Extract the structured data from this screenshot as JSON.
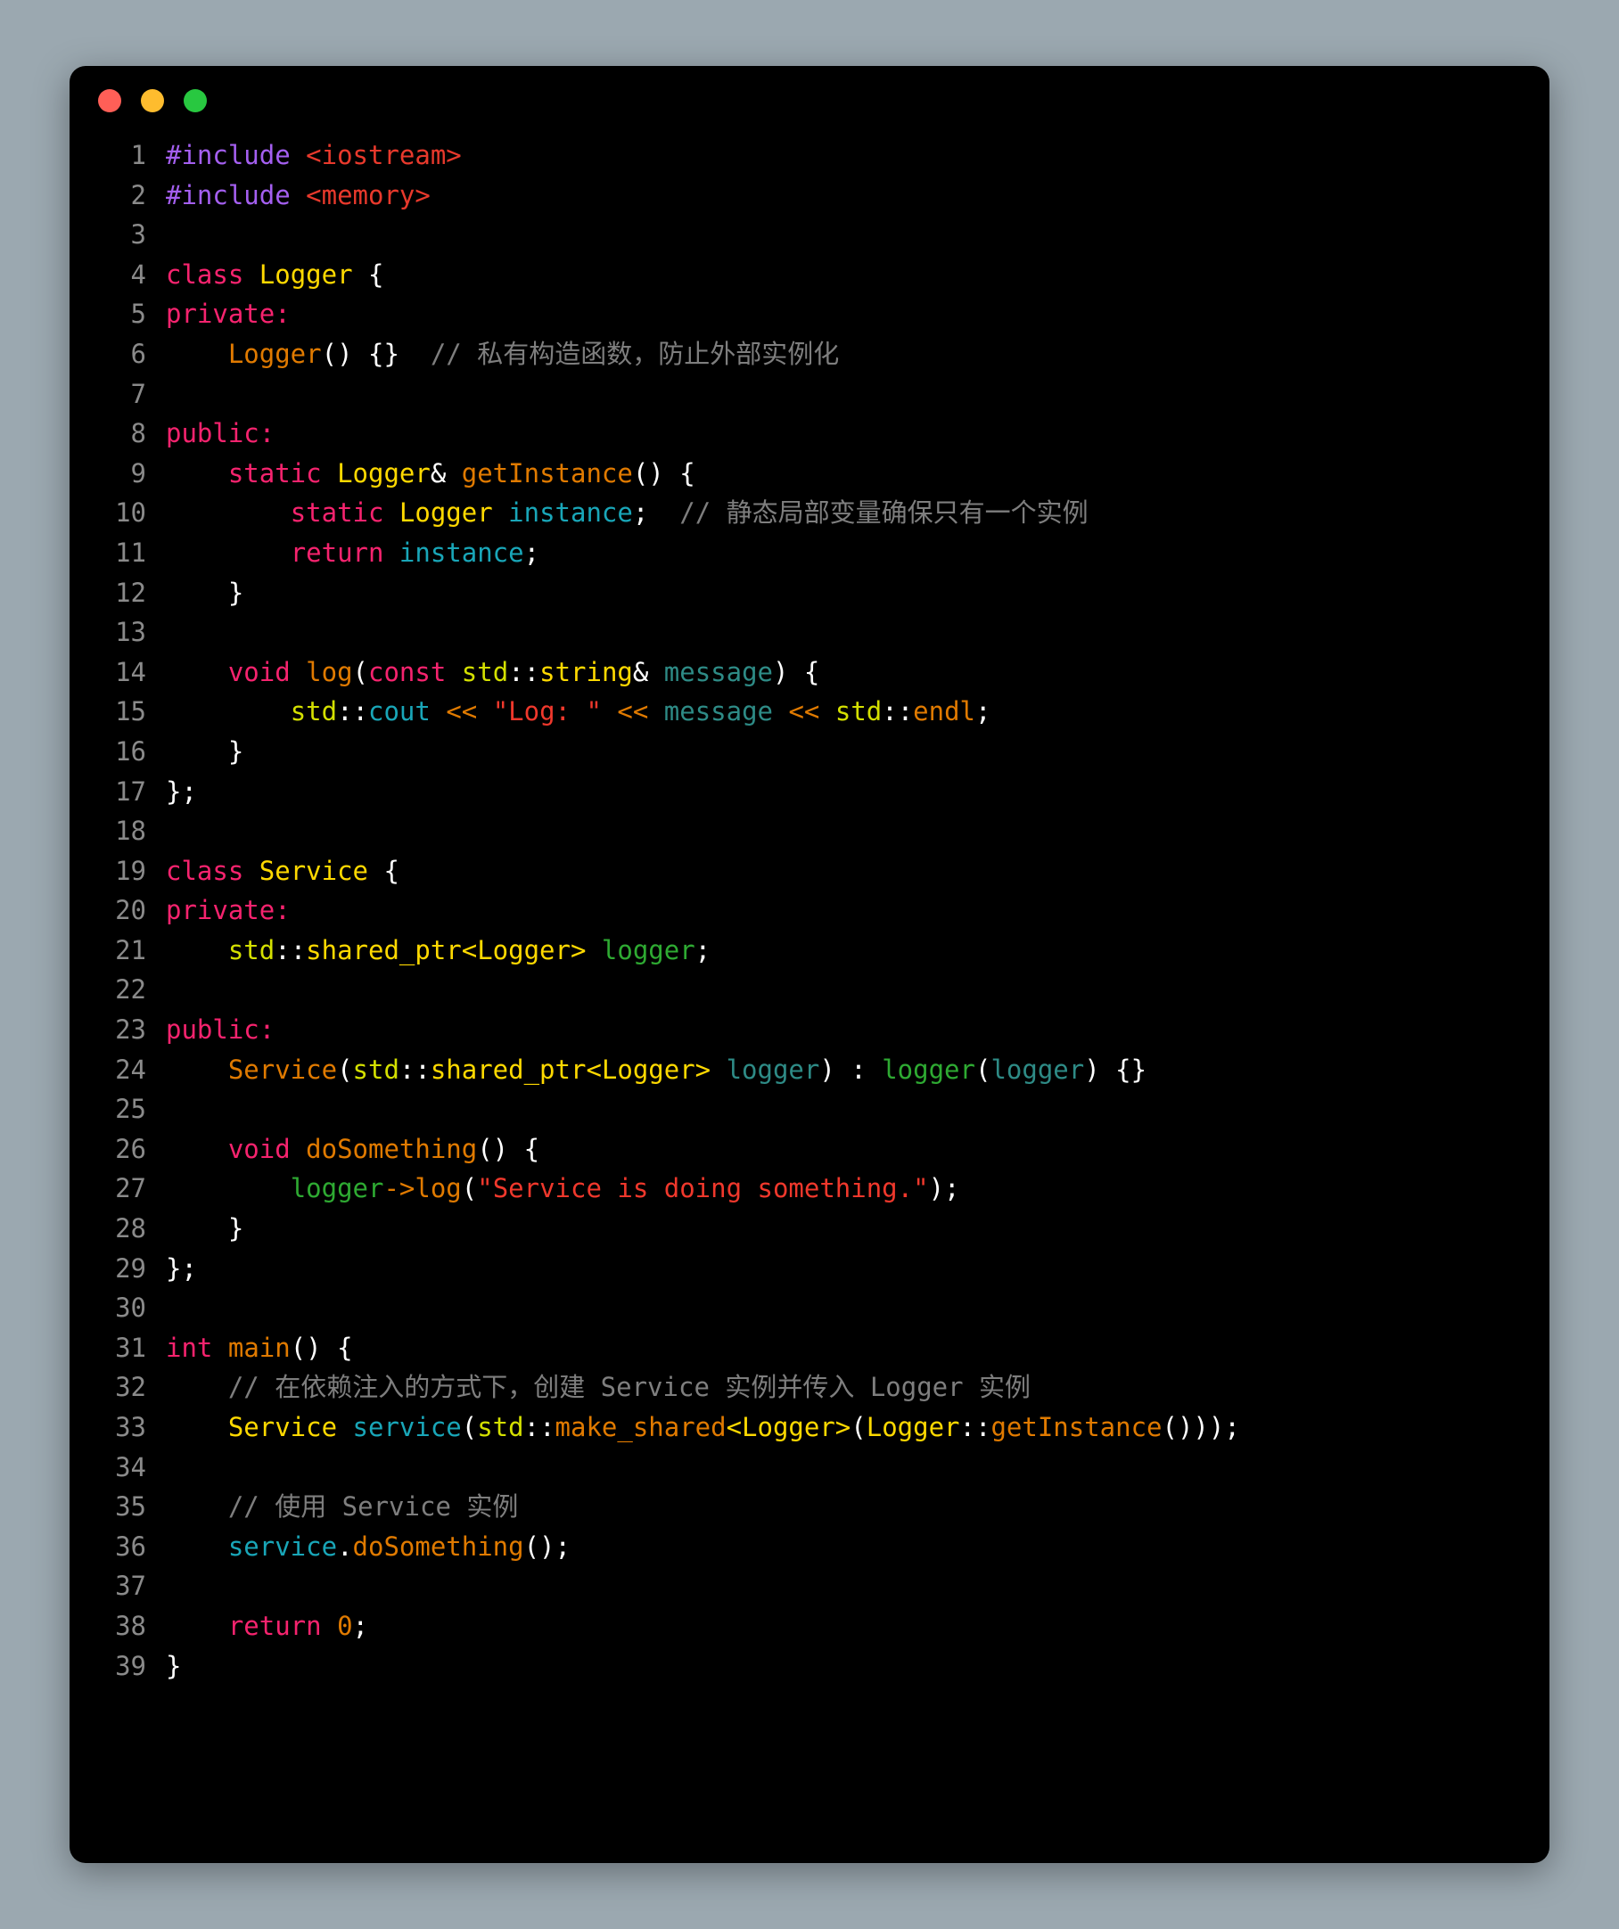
{
  "window": {
    "traffic_lights": [
      {
        "name": "close",
        "color": "#ff5f57"
      },
      {
        "name": "minimize",
        "color": "#febc2e"
      },
      {
        "name": "maximize",
        "color": "#28c840"
      }
    ]
  },
  "editor": {
    "language": "cpp",
    "background": "#000000",
    "line_number_color": "#8a8a8a",
    "total_lines": 39,
    "palette": {
      "preprocessor": "#a45ff0",
      "include_path": "#e8392c",
      "keyword": "#f6236e",
      "type": "#ffd900",
      "namespace": "#d4e000",
      "function": "#e07a00",
      "operator": "#e07a00",
      "variable": "#19a6b8",
      "parameter": "#2e8b86",
      "member": "#2eaa32",
      "string": "#f0382c",
      "comment": "#7e7e7e",
      "punctuation": "#ffffff"
    },
    "lines": [
      {
        "n": "1",
        "text": "#include <iostream>"
      },
      {
        "n": "2",
        "text": "#include <memory>"
      },
      {
        "n": "3",
        "text": ""
      },
      {
        "n": "4",
        "text": "class Logger {"
      },
      {
        "n": "5",
        "text": "private:"
      },
      {
        "n": "6",
        "text": "    Logger() {}  // 私有构造函数，防止外部实例化"
      },
      {
        "n": "7",
        "text": ""
      },
      {
        "n": "8",
        "text": "public:"
      },
      {
        "n": "9",
        "text": "    static Logger& getInstance() {"
      },
      {
        "n": "10",
        "text": "        static Logger instance;  // 静态局部变量确保只有一个实例"
      },
      {
        "n": "11",
        "text": "        return instance;"
      },
      {
        "n": "12",
        "text": "    }"
      },
      {
        "n": "13",
        "text": ""
      },
      {
        "n": "14",
        "text": "    void log(const std::string& message) {"
      },
      {
        "n": "15",
        "text": "        std::cout << \"Log: \" << message << std::endl;"
      },
      {
        "n": "16",
        "text": "    }"
      },
      {
        "n": "17",
        "text": "};"
      },
      {
        "n": "18",
        "text": ""
      },
      {
        "n": "19",
        "text": "class Service {"
      },
      {
        "n": "20",
        "text": "private:"
      },
      {
        "n": "21",
        "text": "    std::shared_ptr<Logger> logger;"
      },
      {
        "n": "22",
        "text": ""
      },
      {
        "n": "23",
        "text": "public:"
      },
      {
        "n": "24",
        "text": "    Service(std::shared_ptr<Logger> logger) : logger(logger) {}"
      },
      {
        "n": "25",
        "text": ""
      },
      {
        "n": "26",
        "text": "    void doSomething() {"
      },
      {
        "n": "27",
        "text": "        logger->log(\"Service is doing something.\");"
      },
      {
        "n": "28",
        "text": "    }"
      },
      {
        "n": "29",
        "text": "};"
      },
      {
        "n": "30",
        "text": ""
      },
      {
        "n": "31",
        "text": "int main() {"
      },
      {
        "n": "32",
        "text": "    // 在依赖注入的方式下，创建 Service 实例并传入 Logger 实例"
      },
      {
        "n": "33",
        "text": "    Service service(std::make_shared<Logger>(Logger::getInstance()));"
      },
      {
        "n": "34",
        "text": ""
      },
      {
        "n": "35",
        "text": "    // 使用 Service 实例"
      },
      {
        "n": "36",
        "text": "    service.doSomething();"
      },
      {
        "n": "37",
        "text": ""
      },
      {
        "n": "38",
        "text": "    return 0;"
      },
      {
        "n": "39",
        "text": "}"
      }
    ],
    "tokens": [
      [
        {
          "c": "pre",
          "t": "#include"
        },
        {
          "c": "pun",
          "t": " "
        },
        {
          "c": "inc",
          "t": "<iostream>"
        }
      ],
      [
        {
          "c": "pre",
          "t": "#include"
        },
        {
          "c": "pun",
          "t": " "
        },
        {
          "c": "inc",
          "t": "<memory>"
        }
      ],
      [],
      [
        {
          "c": "kw",
          "t": "class"
        },
        {
          "c": "pun",
          "t": " "
        },
        {
          "c": "type",
          "t": "Logger"
        },
        {
          "c": "pun",
          "t": " {"
        }
      ],
      [
        {
          "c": "kw",
          "t": "private:"
        }
      ],
      [
        {
          "c": "pun",
          "t": "    "
        },
        {
          "c": "fn",
          "t": "Logger"
        },
        {
          "c": "pun",
          "t": "() {}  "
        },
        {
          "c": "cmt",
          "t": "// 私有构造函数，防止外部实例化"
        }
      ],
      [],
      [
        {
          "c": "kw",
          "t": "public:"
        }
      ],
      [
        {
          "c": "pun",
          "t": "    "
        },
        {
          "c": "kw",
          "t": "static"
        },
        {
          "c": "pun",
          "t": " "
        },
        {
          "c": "type",
          "t": "Logger"
        },
        {
          "c": "pun",
          "t": "& "
        },
        {
          "c": "fn",
          "t": "getInstance"
        },
        {
          "c": "pun",
          "t": "() {"
        }
      ],
      [
        {
          "c": "pun",
          "t": "        "
        },
        {
          "c": "kw",
          "t": "static"
        },
        {
          "c": "pun",
          "t": " "
        },
        {
          "c": "type",
          "t": "Logger"
        },
        {
          "c": "pun",
          "t": " "
        },
        {
          "c": "var",
          "t": "instance"
        },
        {
          "c": "pun",
          "t": ";  "
        },
        {
          "c": "cmt",
          "t": "// 静态局部变量确保只有一个实例"
        }
      ],
      [
        {
          "c": "pun",
          "t": "        "
        },
        {
          "c": "kw",
          "t": "return"
        },
        {
          "c": "pun",
          "t": " "
        },
        {
          "c": "var",
          "t": "instance"
        },
        {
          "c": "pun",
          "t": ";"
        }
      ],
      [
        {
          "c": "pun",
          "t": "    }"
        }
      ],
      [],
      [
        {
          "c": "pun",
          "t": "    "
        },
        {
          "c": "kw",
          "t": "void"
        },
        {
          "c": "pun",
          "t": " "
        },
        {
          "c": "fn",
          "t": "log"
        },
        {
          "c": "pun",
          "t": "("
        },
        {
          "c": "kw",
          "t": "const"
        },
        {
          "c": "pun",
          "t": " "
        },
        {
          "c": "ns",
          "t": "std"
        },
        {
          "c": "pun",
          "t": "::"
        },
        {
          "c": "type",
          "t": "string"
        },
        {
          "c": "pun",
          "t": "& "
        },
        {
          "c": "param",
          "t": "message"
        },
        {
          "c": "pun",
          "t": ") {"
        }
      ],
      [
        {
          "c": "pun",
          "t": "        "
        },
        {
          "c": "ns",
          "t": "std"
        },
        {
          "c": "pun",
          "t": "::"
        },
        {
          "c": "var",
          "t": "cout"
        },
        {
          "c": "pun",
          "t": " "
        },
        {
          "c": "op",
          "t": "<<"
        },
        {
          "c": "pun",
          "t": " "
        },
        {
          "c": "str",
          "t": "\"Log: \""
        },
        {
          "c": "pun",
          "t": " "
        },
        {
          "c": "op",
          "t": "<<"
        },
        {
          "c": "pun",
          "t": " "
        },
        {
          "c": "param",
          "t": "message"
        },
        {
          "c": "pun",
          "t": " "
        },
        {
          "c": "op",
          "t": "<<"
        },
        {
          "c": "pun",
          "t": " "
        },
        {
          "c": "ns",
          "t": "std"
        },
        {
          "c": "pun",
          "t": "::"
        },
        {
          "c": "fn",
          "t": "endl"
        },
        {
          "c": "pun",
          "t": ";"
        }
      ],
      [
        {
          "c": "pun",
          "t": "    }"
        }
      ],
      [
        {
          "c": "pun",
          "t": "};"
        }
      ],
      [],
      [
        {
          "c": "kw",
          "t": "class"
        },
        {
          "c": "pun",
          "t": " "
        },
        {
          "c": "type",
          "t": "Service"
        },
        {
          "c": "pun",
          "t": " {"
        }
      ],
      [
        {
          "c": "kw",
          "t": "private:"
        }
      ],
      [
        {
          "c": "pun",
          "t": "    "
        },
        {
          "c": "ns",
          "t": "std"
        },
        {
          "c": "pun",
          "t": "::"
        },
        {
          "c": "type",
          "t": "shared_ptr<Logger>"
        },
        {
          "c": "pun",
          "t": " "
        },
        {
          "c": "mem",
          "t": "logger"
        },
        {
          "c": "pun",
          "t": ";"
        }
      ],
      [],
      [
        {
          "c": "kw",
          "t": "public:"
        }
      ],
      [
        {
          "c": "pun",
          "t": "    "
        },
        {
          "c": "fn",
          "t": "Service"
        },
        {
          "c": "pun",
          "t": "("
        },
        {
          "c": "ns",
          "t": "std"
        },
        {
          "c": "pun",
          "t": "::"
        },
        {
          "c": "type",
          "t": "shared_ptr<Logger>"
        },
        {
          "c": "pun",
          "t": " "
        },
        {
          "c": "param",
          "t": "logger"
        },
        {
          "c": "pun",
          "t": ") : "
        },
        {
          "c": "mem",
          "t": "logger"
        },
        {
          "c": "pun",
          "t": "("
        },
        {
          "c": "param",
          "t": "logger"
        },
        {
          "c": "pun",
          "t": ") {}"
        }
      ],
      [],
      [
        {
          "c": "pun",
          "t": "    "
        },
        {
          "c": "kw",
          "t": "void"
        },
        {
          "c": "pun",
          "t": " "
        },
        {
          "c": "fn",
          "t": "doSomething"
        },
        {
          "c": "pun",
          "t": "() {"
        }
      ],
      [
        {
          "c": "pun",
          "t": "        "
        },
        {
          "c": "mem",
          "t": "logger"
        },
        {
          "c": "op",
          "t": "->"
        },
        {
          "c": "fn",
          "t": "log"
        },
        {
          "c": "pun",
          "t": "("
        },
        {
          "c": "str",
          "t": "\"Service is doing something.\""
        },
        {
          "c": "pun",
          "t": ");"
        }
      ],
      [
        {
          "c": "pun",
          "t": "    }"
        }
      ],
      [
        {
          "c": "pun",
          "t": "};"
        }
      ],
      [],
      [
        {
          "c": "kw",
          "t": "int"
        },
        {
          "c": "pun",
          "t": " "
        },
        {
          "c": "fn",
          "t": "main"
        },
        {
          "c": "pun",
          "t": "() {"
        }
      ],
      [
        {
          "c": "pun",
          "t": "    "
        },
        {
          "c": "cmt",
          "t": "// 在依赖注入的方式下，创建 Service 实例并传入 Logger 实例"
        }
      ],
      [
        {
          "c": "pun",
          "t": "    "
        },
        {
          "c": "type",
          "t": "Service"
        },
        {
          "c": "pun",
          "t": " "
        },
        {
          "c": "var",
          "t": "service"
        },
        {
          "c": "pun",
          "t": "("
        },
        {
          "c": "ns",
          "t": "std"
        },
        {
          "c": "pun",
          "t": "::"
        },
        {
          "c": "fn",
          "t": "make_shared"
        },
        {
          "c": "type",
          "t": "<Logger>"
        },
        {
          "c": "pun",
          "t": "("
        },
        {
          "c": "type",
          "t": "Logger"
        },
        {
          "c": "pun",
          "t": "::"
        },
        {
          "c": "fn",
          "t": "getInstance"
        },
        {
          "c": "pun",
          "t": "()));"
        }
      ],
      [],
      [
        {
          "c": "pun",
          "t": "    "
        },
        {
          "c": "cmt",
          "t": "// 使用 Service 实例"
        }
      ],
      [
        {
          "c": "pun",
          "t": "    "
        },
        {
          "c": "var",
          "t": "service"
        },
        {
          "c": "pun",
          "t": "."
        },
        {
          "c": "fn",
          "t": "doSomething"
        },
        {
          "c": "pun",
          "t": "();"
        }
      ],
      [],
      [
        {
          "c": "pun",
          "t": "    "
        },
        {
          "c": "kw",
          "t": "return"
        },
        {
          "c": "pun",
          "t": " "
        },
        {
          "c": "fn",
          "t": "0"
        },
        {
          "c": "pun",
          "t": ";"
        }
      ],
      [
        {
          "c": "pun",
          "t": "}"
        }
      ]
    ]
  }
}
